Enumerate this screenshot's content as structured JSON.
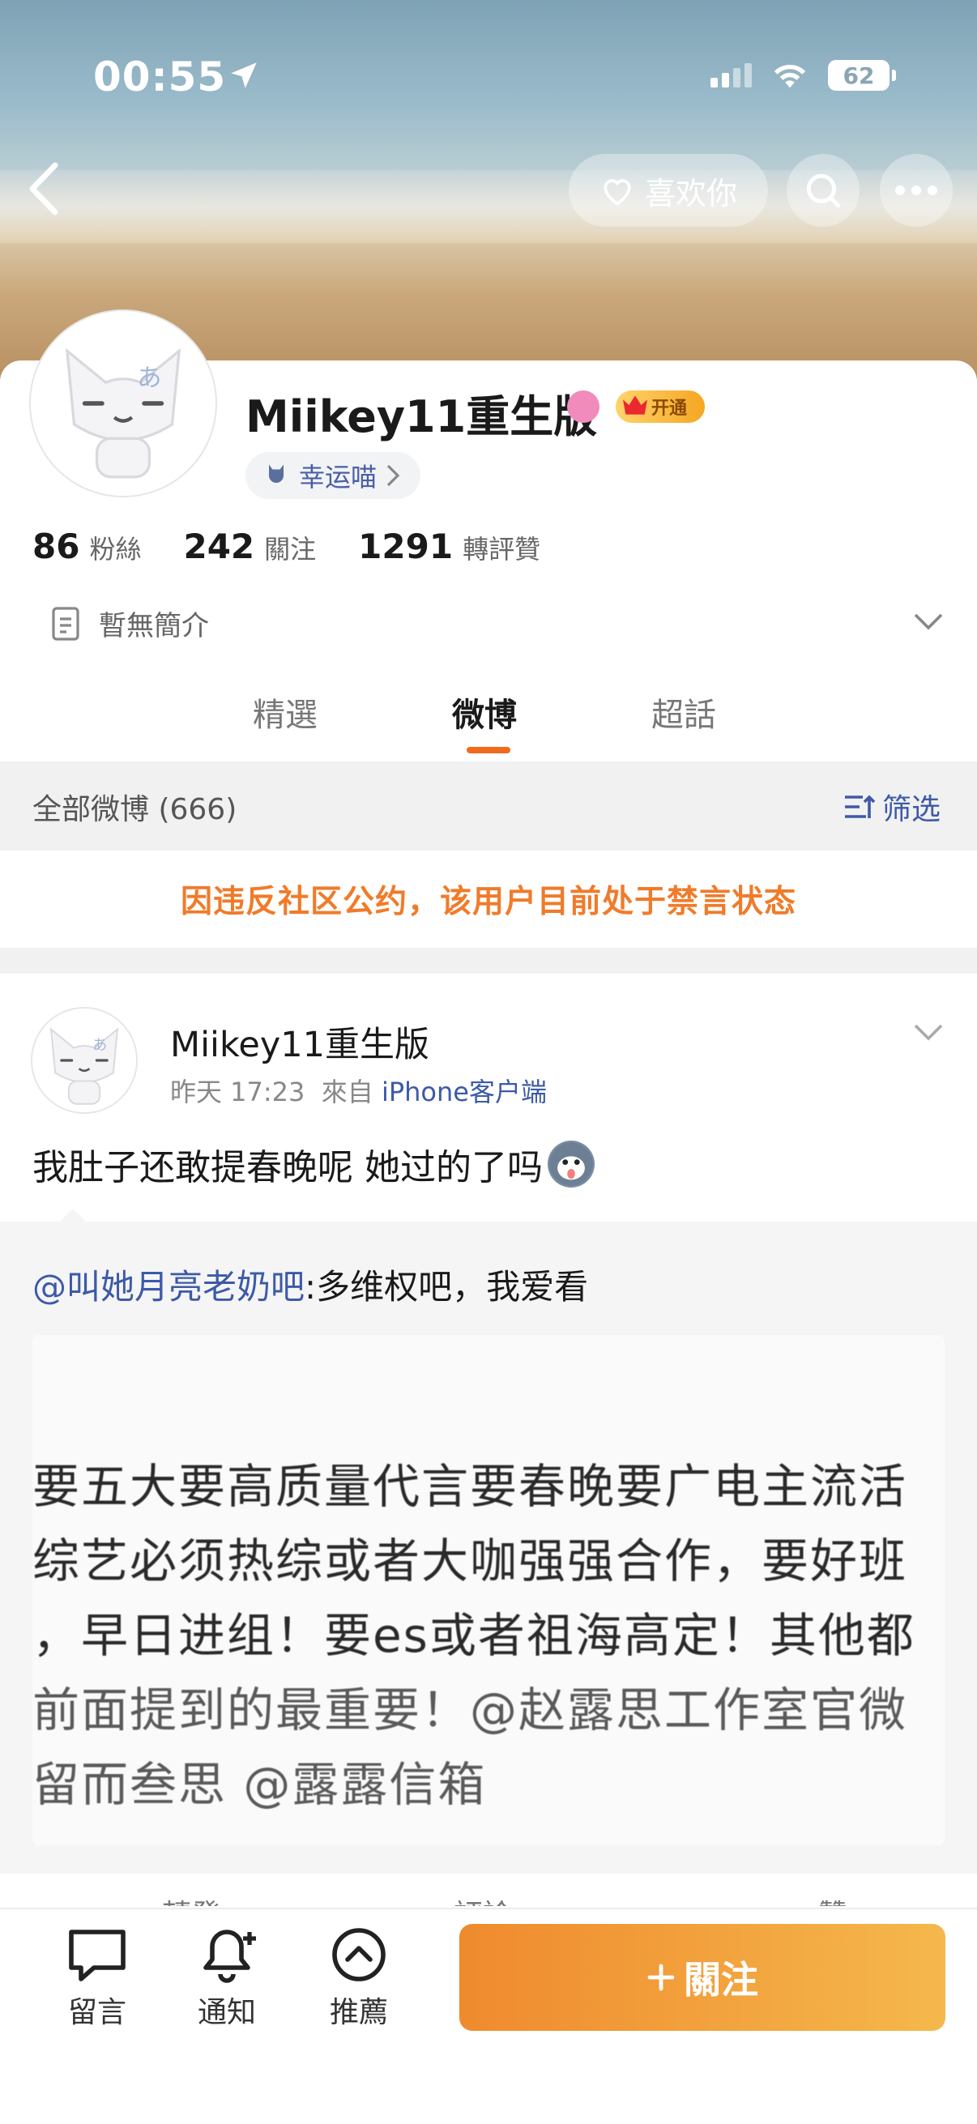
{
  "status_bar": {
    "time": "00:55",
    "battery": "62"
  },
  "header": {
    "like_label": "喜欢你"
  },
  "profile": {
    "username": "Miikey11重生版",
    "vip_label": "开通",
    "lucky_label": "幸运喵",
    "stats": [
      {
        "num": "86",
        "label": "粉絲"
      },
      {
        "num": "242",
        "label": "關注"
      },
      {
        "num": "1291",
        "label": "轉評贊"
      }
    ],
    "bio": "暫無簡介"
  },
  "tabs": [
    {
      "label": "精選"
    },
    {
      "label": "微博"
    },
    {
      "label": "超話"
    }
  ],
  "filter": {
    "title": "全部微博 (666)",
    "filter_label": "筛选"
  },
  "notice": "因违反社区公约，该用户目前处于禁言状态",
  "post": {
    "author": "Miikey11重生版",
    "time": "昨天 17:23",
    "from": "來自",
    "source": "iPhone客户端",
    "text": "我肚子还敢提春晚呢 她过的了吗",
    "repost": {
      "mention": "@叫她月亮老奶吧",
      "text": ":多维权吧，我爱看",
      "image_lines": [
        "要五大要高质量代言要春晚要广电主流活",
        "综艺必须热综或者大咖强强合作，要好班",
        "，早日进组！要es或者祖海高定！其他都",
        "前面提到的最重要！@赵露思工作室官微",
        "留而叁思 @露露信箱"
      ]
    },
    "actions": [
      "轉發",
      "評論",
      "贊"
    ]
  },
  "bottom_bar": {
    "message": "留言",
    "notify": "通知",
    "recommend": "推薦",
    "follow": "關注"
  }
}
